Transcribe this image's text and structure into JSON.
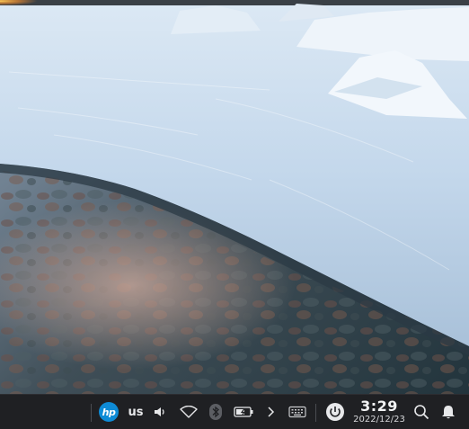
{
  "desktop": {
    "wallpaper": "frozen-lake-shore-at-sunset"
  },
  "taskbar": {
    "launcher_icon": "hp-logo-icon",
    "hp_logo_text": "hp",
    "keyboard_language": "us",
    "tray_icons": [
      "volume-icon",
      "wifi-icon",
      "bluetooth-icon",
      "battery-icon",
      "chevron-right-icon",
      "virtual-keyboard-icon"
    ],
    "power_icon": "power-icon",
    "clock": {
      "time": "3:29",
      "date": "2022/12/23"
    },
    "search_icon": "search-icon",
    "notifications_icon": "bell-icon"
  },
  "colors": {
    "taskbar_bg": "#1f2023",
    "taskbar_fg": "#e7e8ea",
    "hp_blue": "#0e8bd6"
  }
}
